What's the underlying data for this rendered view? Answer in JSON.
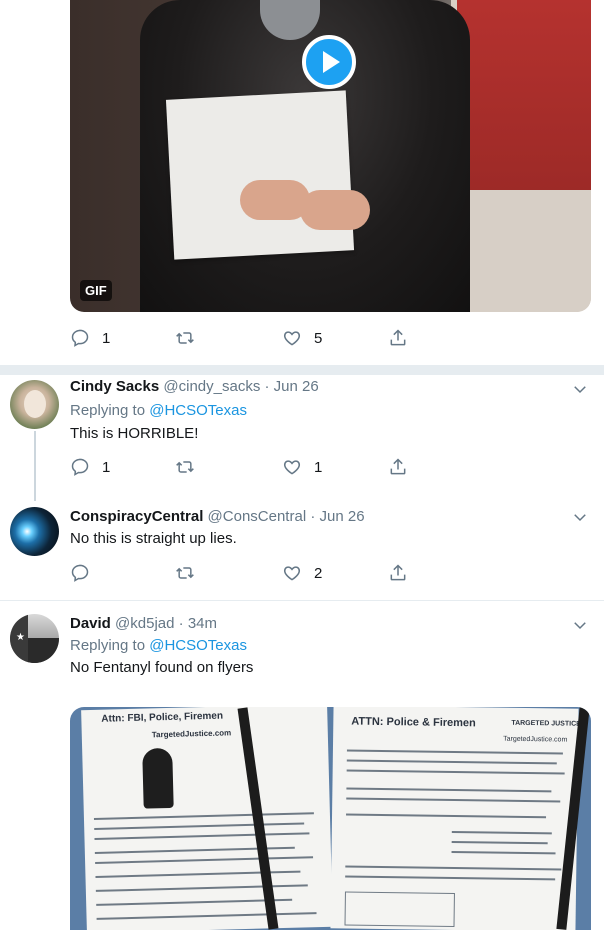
{
  "top_media": {
    "badge": "GIF"
  },
  "tweets": [
    {
      "actions": {
        "reply_count": "1",
        "retweet_count": "",
        "like_count": "5"
      }
    },
    {
      "name": "Cindy Sacks",
      "handle": "@cindy_sacks",
      "dot": "·",
      "time": "Jun 26",
      "replying_prefix": "Replying to",
      "replying_to": "@HCSOTexas",
      "text": "This is HORRIBLE!",
      "actions": {
        "reply_count": "1",
        "retweet_count": "",
        "like_count": "1"
      }
    },
    {
      "name": "ConspiracyCentral",
      "handle": "@ConsCentral",
      "dot": "·",
      "time": "Jun 26",
      "text": "No this is straight up lies.",
      "actions": {
        "reply_count": "",
        "retweet_count": "",
        "like_count": "2"
      }
    },
    {
      "name": "David",
      "handle": "@kd5jad",
      "dot": "·",
      "time": "34m",
      "replying_prefix": "Replying to",
      "replying_to": "@HCSOTexas",
      "text": "No Fentanyl found on flyers"
    }
  ],
  "bottom_media": {
    "flyer_left_title": "Attn: FBI, Police, Firemen",
    "flyer_left_site": "TargetedJustice.com",
    "flyer_right_title": "ATTN: Police & Firemen",
    "flyer_right_logo": "TARGETED JUSTICE",
    "flyer_right_site": "TargetedJustice.com"
  },
  "colors": {
    "accent": "#1da1f2",
    "mention": "#1b95e0",
    "secondary_text": "#657786",
    "divider": "#e6ecf0"
  },
  "icons": [
    "reply-icon",
    "retweet-icon",
    "like-icon",
    "share-icon",
    "chevron-down-icon",
    "play-icon"
  ]
}
